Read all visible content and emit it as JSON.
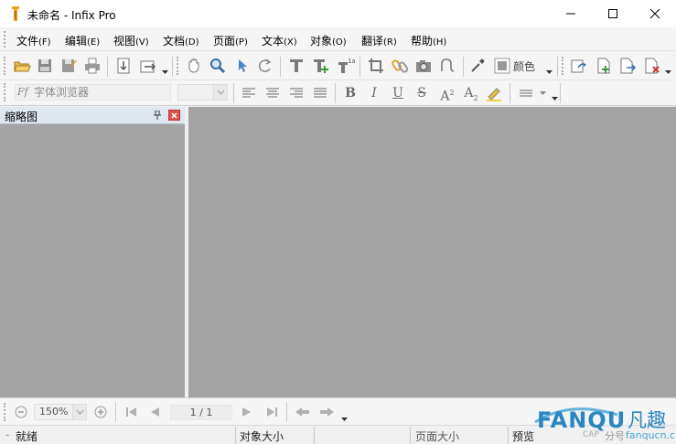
{
  "window": {
    "title": "未命名 - Infix Pro"
  },
  "menu": [
    {
      "label": "文件",
      "accel": "(F)"
    },
    {
      "label": "编辑",
      "accel": "(E)"
    },
    {
      "label": "视图",
      "accel": "(V)"
    },
    {
      "label": "文档",
      "accel": "(D)"
    },
    {
      "label": "页面",
      "accel": "(P)"
    },
    {
      "label": "文本",
      "accel": "(X)"
    },
    {
      "label": "对象",
      "accel": "(O)"
    },
    {
      "label": "翻译",
      "accel": "(R)"
    },
    {
      "label": "帮助",
      "accel": "(H)"
    }
  ],
  "toolbar": {
    "color_label": "颜色"
  },
  "format_bar": {
    "font_placeholder": "字体浏览器",
    "font_prefix": "Ff"
  },
  "thumbnails": {
    "title": "缩略图"
  },
  "navigation": {
    "zoom": "150%",
    "page": "1 / 1"
  },
  "status": {
    "ready": "就绪",
    "object_size": "对象大小",
    "page_size": "页面大小",
    "preview": "预览",
    "caps": "CAP"
  },
  "watermark": {
    "brand": "FANQU",
    "brand_cn": "凡趣",
    "sub": "分号",
    "site": "fanqucn.cn"
  },
  "colors": {
    "canvas": "#a3a3a3",
    "panel_header": "#dfe7f0",
    "close_red": "#d9534f"
  }
}
